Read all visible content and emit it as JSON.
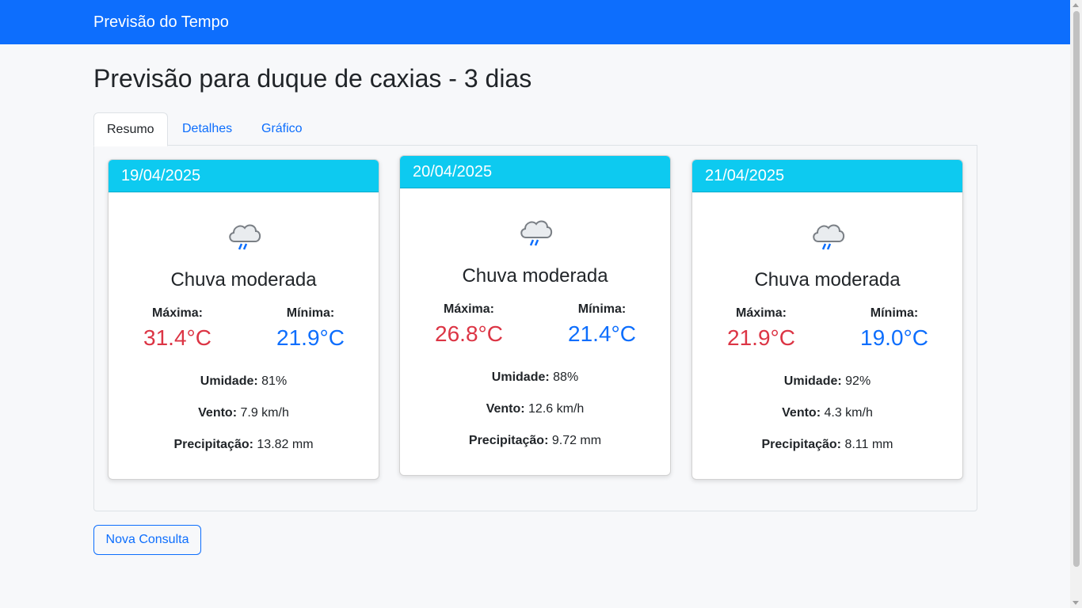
{
  "navbar": {
    "brand": "Previsão do Tempo"
  },
  "page": {
    "title": "Previsão para duque de caxias - 3 dias"
  },
  "tabs": [
    {
      "label": "Resumo",
      "active": true
    },
    {
      "label": "Detalhes",
      "active": false
    },
    {
      "label": "Gráfico",
      "active": false
    }
  ],
  "labels": {
    "max": "Máxima:",
    "min": "Mínima:",
    "humidity": "Umidade:",
    "wind": "Vento:",
    "precip": "Precipitação:"
  },
  "days": [
    {
      "date": "19/04/2025",
      "icon": "rain-cloud-icon",
      "condition": "Chuva moderada",
      "max": "31.4°C",
      "min": "21.9°C",
      "humidity": "81%",
      "wind": "7.9 km/h",
      "precip": "13.82 mm"
    },
    {
      "date": "20/04/2025",
      "icon": "rain-cloud-icon",
      "condition": "Chuva moderada",
      "max": "26.8°C",
      "min": "21.4°C",
      "humidity": "88%",
      "wind": "12.6 km/h",
      "precip": "9.72 mm"
    },
    {
      "date": "21/04/2025",
      "icon": "rain-cloud-icon",
      "condition": "Chuva moderada",
      "max": "21.9°C",
      "min": "19.0°C",
      "humidity": "92%",
      "wind": "4.3 km/h",
      "precip": "8.11 mm"
    }
  ],
  "actions": {
    "new_query": "Nova Consulta"
  },
  "colors": {
    "primary": "#0d6efd",
    "header": "#0dcaf0",
    "max_temp": "#dc3545",
    "min_temp": "#0d6efd"
  }
}
